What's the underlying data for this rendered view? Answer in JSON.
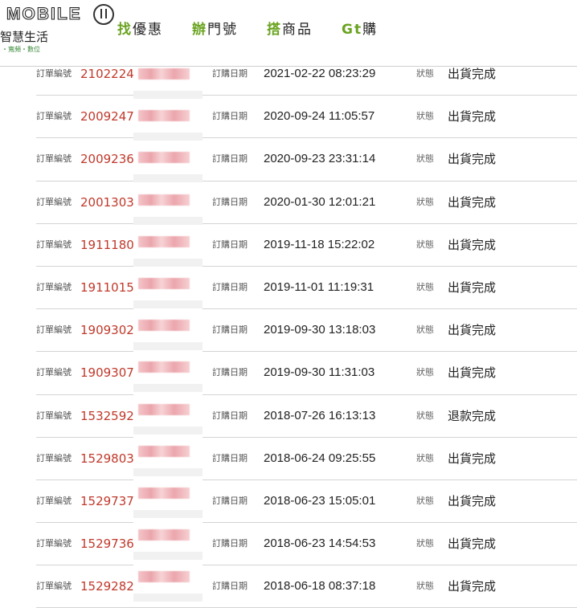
{
  "header": {
    "logo_text": "MOBILE",
    "logo_sub": "智慧生活",
    "logo_tagline": "・寬頻・數位",
    "nav": [
      {
        "accent": "找",
        "rest": "優惠"
      },
      {
        "accent": "辦",
        "rest": "門號"
      },
      {
        "accent": "搭",
        "rest": "商品"
      },
      {
        "accent": "Gt",
        "rest": "購"
      }
    ]
  },
  "labels": {
    "order_no": "訂單編號",
    "order_date": "訂購日期",
    "status": "狀態"
  },
  "orders": [
    {
      "order_no": "2102224",
      "date": "2021-02-22 08:23:29",
      "status": "出貨完成"
    },
    {
      "order_no": "2009247",
      "date": "2020-09-24 11:05:57",
      "status": "出貨完成"
    },
    {
      "order_no": "2009236",
      "date": "2020-09-23 23:31:14",
      "status": "出貨完成"
    },
    {
      "order_no": "2001303",
      "date": "2020-01-30 12:01:21",
      "status": "出貨完成"
    },
    {
      "order_no": "1911180",
      "date": "2019-11-18 15:22:02",
      "status": "出貨完成"
    },
    {
      "order_no": "1911015",
      "date": "2019-11-01 11:19:31",
      "status": "出貨完成"
    },
    {
      "order_no": "1909302",
      "date": "2019-09-30 13:18:03",
      "status": "出貨完成"
    },
    {
      "order_no": "1909307",
      "date": "2019-09-30 11:31:03",
      "status": "出貨完成"
    },
    {
      "order_no": "1532592",
      "date": "2018-07-26 16:13:13",
      "status": "退款完成"
    },
    {
      "order_no": "1529803",
      "date": "2018-06-24 09:25:55",
      "status": "出貨完成"
    },
    {
      "order_no": "1529737",
      "date": "2018-06-23 15:05:01",
      "status": "出貨完成"
    },
    {
      "order_no": "1529736",
      "date": "2018-06-23 14:54:53",
      "status": "出貨完成"
    },
    {
      "order_no": "1529282",
      "date": "2018-06-18 08:37:18",
      "status": "出貨完成"
    }
  ]
}
